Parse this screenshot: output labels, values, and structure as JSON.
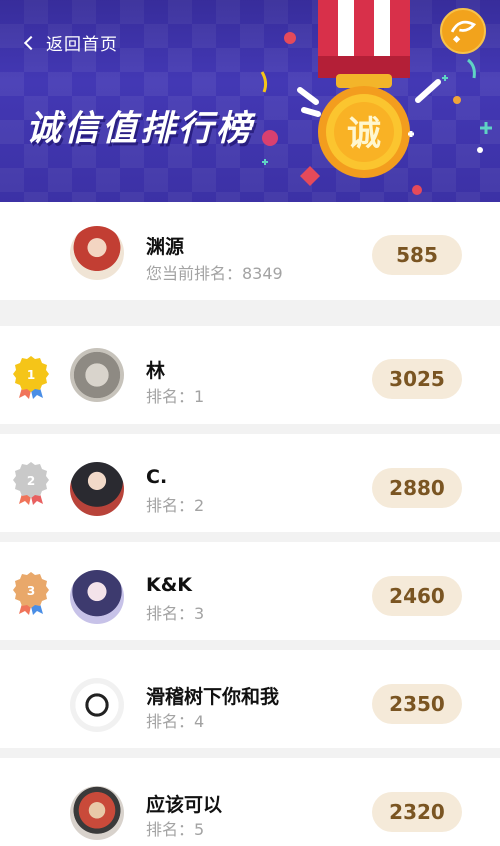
{
  "header": {
    "back_label": "返回首页",
    "title": "诚信值排行榜",
    "medal_char": "诚"
  },
  "me": {
    "name": "渊源",
    "rank_text": "您当前排名：8349",
    "score": "585"
  },
  "ranking": [
    {
      "name": "林",
      "rank_text": "排名：1",
      "score": "3025",
      "medal": "1",
      "medal_color": "#f5c518"
    },
    {
      "name": "C.",
      "rank_text": "排名：2",
      "score": "2880",
      "medal": "2",
      "medal_color": "#c9c9c9"
    },
    {
      "name": "K&K",
      "rank_text": "排名：3",
      "score": "2460",
      "medal": "3",
      "medal_color": "#e9a86a"
    },
    {
      "name": "滑稽树下你和我",
      "rank_text": "排名：4",
      "score": "2350"
    },
    {
      "name": "应该可以",
      "rank_text": "排名：5",
      "score": "2320"
    }
  ],
  "colors": {
    "banner_bg": "#4338b4",
    "score_pill_bg": "#f5ead9",
    "score_text": "#7a5522",
    "gold": "#f5c518",
    "silver": "#c9c9c9",
    "bronze": "#e9a86a"
  }
}
